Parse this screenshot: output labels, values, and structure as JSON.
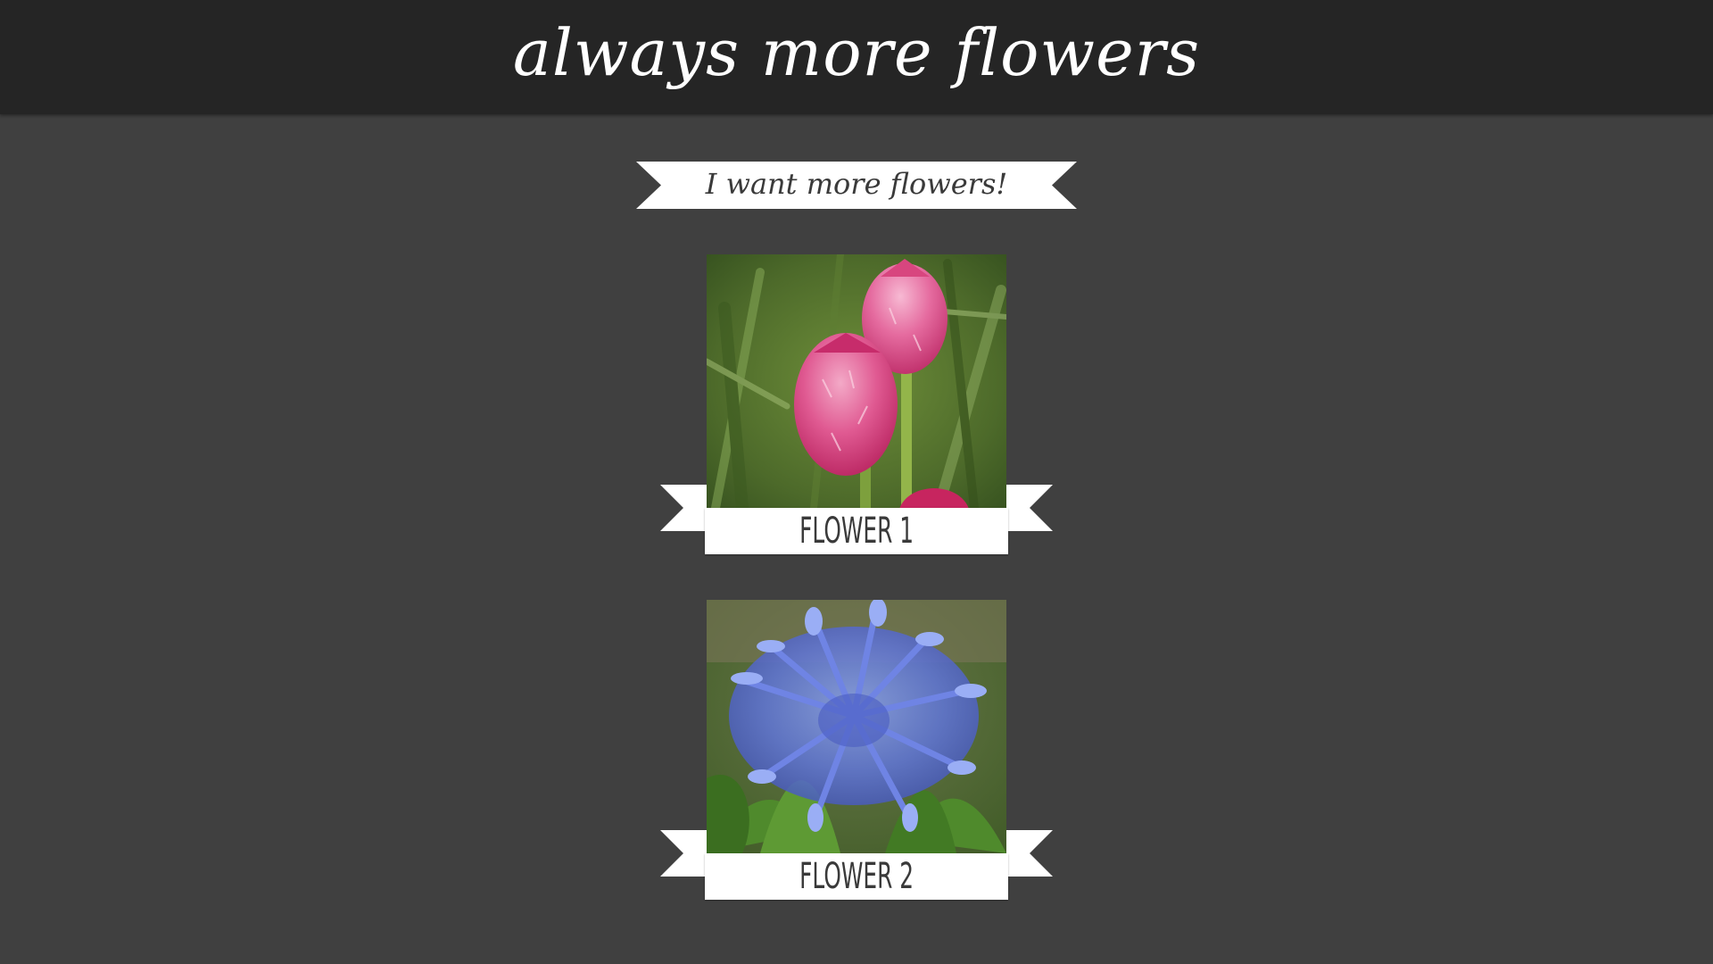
{
  "header": {
    "title": "always more flowers"
  },
  "action": {
    "button_label": "I want more flowers!"
  },
  "flowers": [
    {
      "caption": "FLOWER 1",
      "image": "pink-orchid-photo"
    },
    {
      "caption": "FLOWER 2",
      "image": "blue-agapanthus-photo"
    }
  ],
  "colors": {
    "header_bg": "#252525",
    "page_bg": "#404040",
    "ribbon": "#ffffff",
    "ribbon_text": "#3a3a3a"
  }
}
